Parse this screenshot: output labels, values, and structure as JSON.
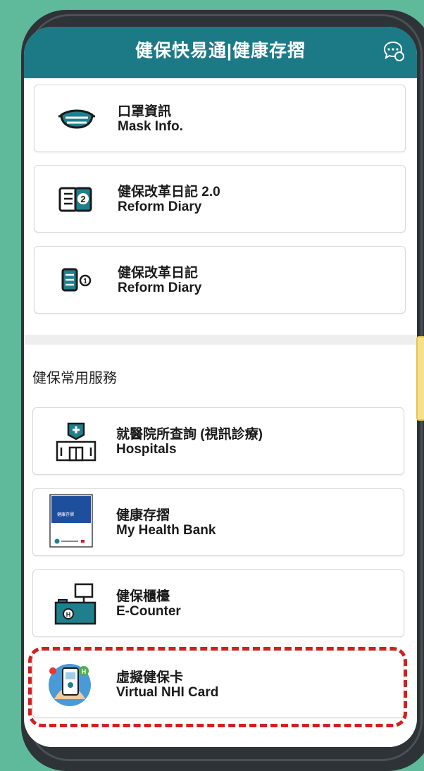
{
  "header": {
    "title": "健保快易通|健康存摺"
  },
  "cards_top": [
    {
      "title": "口罩資訊",
      "subtitle": "Mask Info.",
      "icon": "mask-icon"
    },
    {
      "title": "健保改革日記 2.0",
      "subtitle": "Reform Diary",
      "icon": "reform-diary-2-icon"
    },
    {
      "title": "健保改革日記",
      "subtitle": "Reform Diary",
      "icon": "reform-diary-1-icon"
    }
  ],
  "section": {
    "title": "健保常用服務"
  },
  "cards_services": [
    {
      "title": "就醫院所查詢 (視訊診療)",
      "subtitle": "Hospitals",
      "icon": "hospital-icon"
    },
    {
      "title": "健康存摺",
      "subtitle": "My Health Bank",
      "icon": "health-bank-icon"
    },
    {
      "title": "健保櫃檯",
      "subtitle": "E-Counter",
      "icon": "counter-icon"
    },
    {
      "title": "虛擬健保卡",
      "subtitle": "Virtual NHI Card",
      "icon": "virtual-card-icon"
    }
  ],
  "colors": {
    "background": "#5fb99b",
    "header": "#1b7a85",
    "icon_teal": "#1f7f8d",
    "highlight_red": "#d21f1f"
  }
}
